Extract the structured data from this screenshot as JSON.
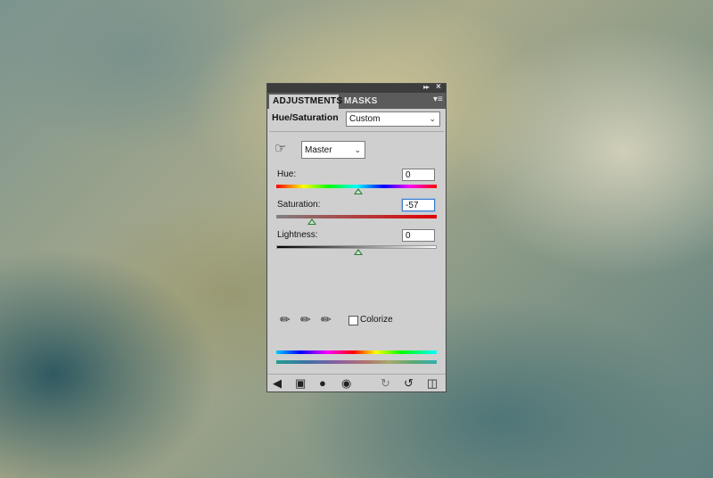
{
  "panel": {
    "collapse_icon": "double-chevron-right-icon",
    "close_icon": "close-icon",
    "menu_icon": "panel-menu-icon",
    "tabs": [
      {
        "label": "ADJUSTMENTS"
      },
      {
        "label": "MASKS"
      }
    ]
  },
  "adjustment": {
    "title": "Hue/Saturation",
    "preset_value": "Custom",
    "channel_value": "Master",
    "hand_tool_icon": "targeted-adjustment-hand-icon",
    "hue": {
      "label": "Hue:",
      "value": "0"
    },
    "saturation": {
      "label": "Saturation:",
      "value": "-57"
    },
    "lightness": {
      "label": "Lightness:",
      "value": "0"
    },
    "colorize_label": "Colorize",
    "colorize_checked": false
  },
  "bottom_icons": [
    "back-arrow-icon",
    "expanded-view-icon",
    "clip-to-layer-icon",
    "visibility-eye-icon",
    "view-previous-state-icon",
    "reset-icon",
    "delete-trash-icon"
  ]
}
